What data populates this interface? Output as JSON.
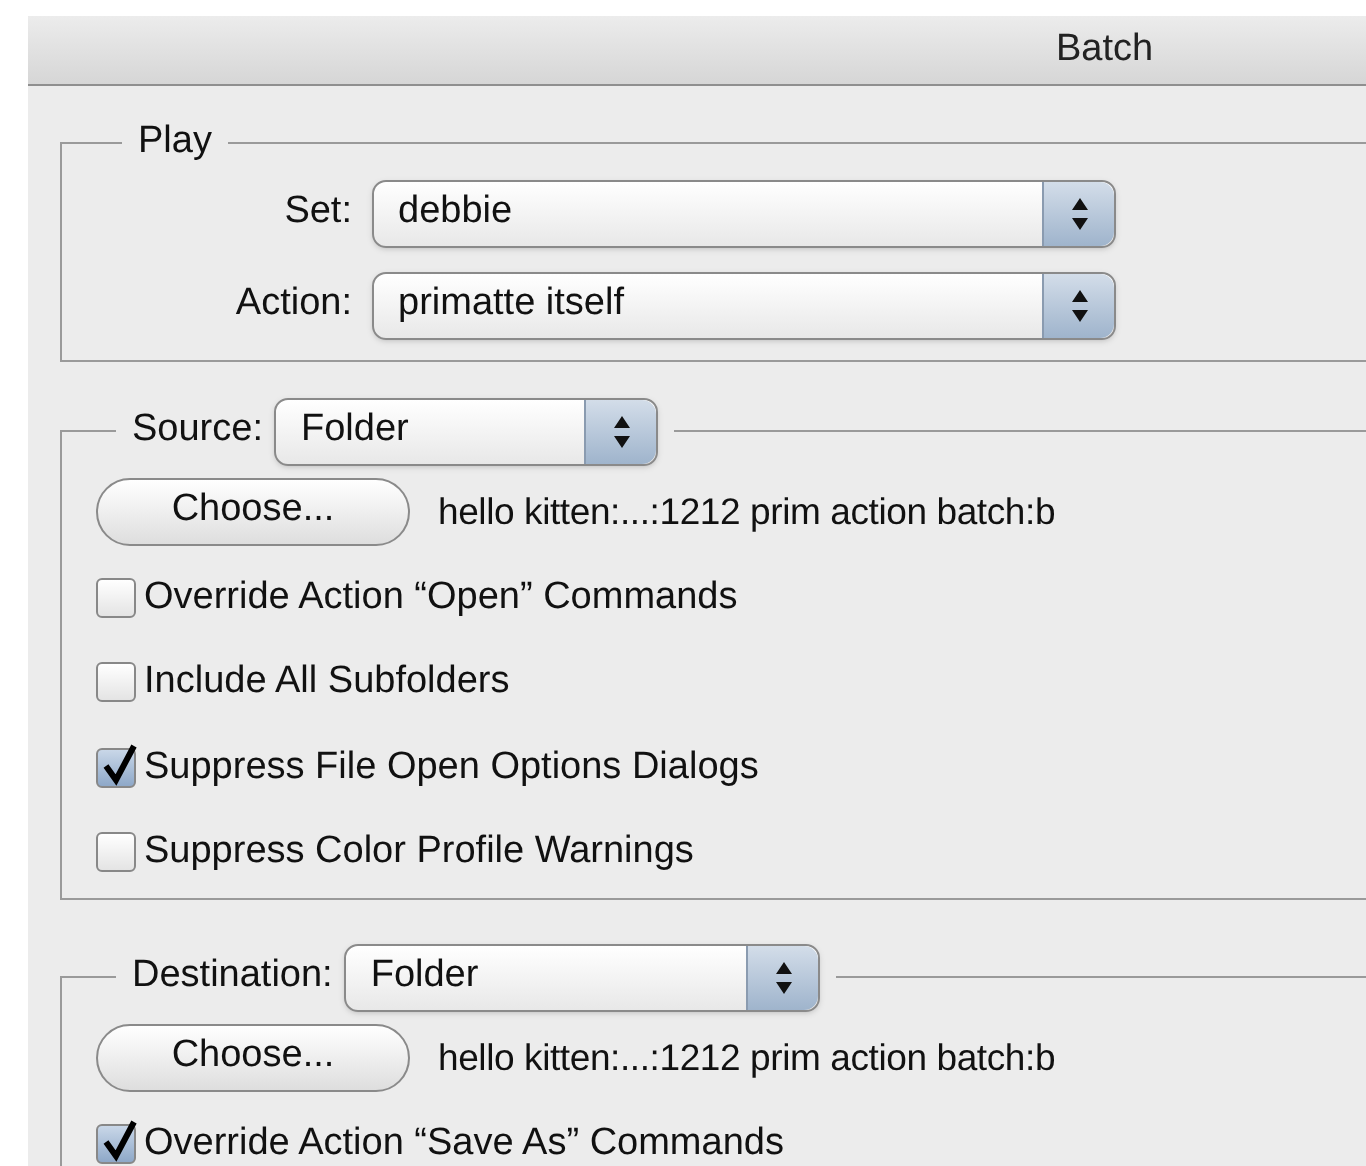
{
  "window": {
    "title": "Batch"
  },
  "play": {
    "legend": "Play",
    "fields": [
      {
        "label": "Set:",
        "value": "debbie"
      },
      {
        "label": "Action:",
        "value": "primatte itself"
      }
    ]
  },
  "source": {
    "label": "Source:",
    "value": "Folder",
    "choose_button": "Choose...",
    "path": "hello kitten:...:1212 prim action batch:b",
    "options": [
      {
        "label": "Override Action “Open” Commands",
        "checked": false
      },
      {
        "label": "Include All Subfolders",
        "checked": false
      },
      {
        "label": "Suppress File Open Options Dialogs",
        "checked": true
      },
      {
        "label": "Suppress Color Profile Warnings",
        "checked": false
      }
    ]
  },
  "destination": {
    "label": "Destination:",
    "value": "Folder",
    "choose_button": "Choose...",
    "path": "hello kitten:...:1212 prim action batch:b",
    "options": [
      {
        "label": "Override Action “Save As” Commands",
        "checked": true
      }
    ]
  }
}
